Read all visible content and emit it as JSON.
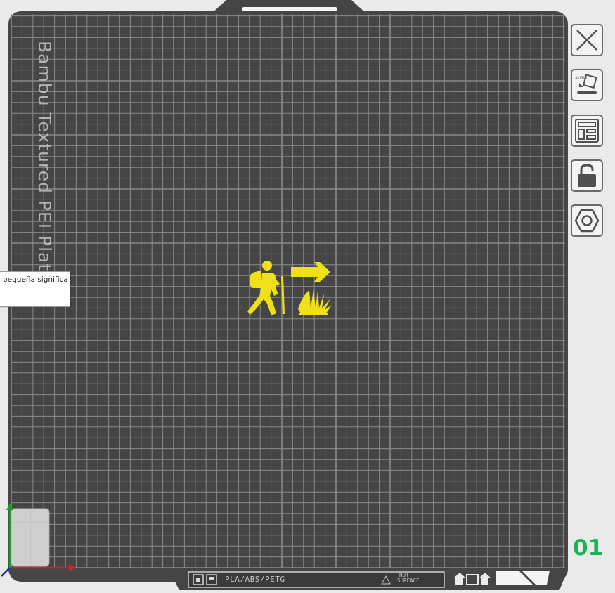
{
  "plate": {
    "label": "Bambu Textured PEI Plate",
    "bottom_label": "PLA/ABS/PETG",
    "hot_surface_line1": "HOT",
    "hot_surface_line2": "SURFACE",
    "number": "01",
    "plate_color": "#454545",
    "grid_color": "#8a8a8a",
    "logo_color": "#f0e01a"
  },
  "toolbar": {
    "buttons": [
      {
        "name": "close",
        "icon": "close-icon"
      },
      {
        "name": "auto-orient",
        "icon": "auto-orient-icon",
        "text": "AUTO"
      },
      {
        "name": "arrange",
        "icon": "arrange-layout-icon"
      },
      {
        "name": "lock",
        "icon": "unlock-icon"
      },
      {
        "name": "plate-settings",
        "icon": "hexagon-settings-icon"
      }
    ]
  },
  "tooltip": {
    "text": "pequeña significa"
  },
  "axes": {
    "x_color": "#d0202a",
    "y_color": "#1d9c2c",
    "z_color": "#1c2f9e"
  }
}
